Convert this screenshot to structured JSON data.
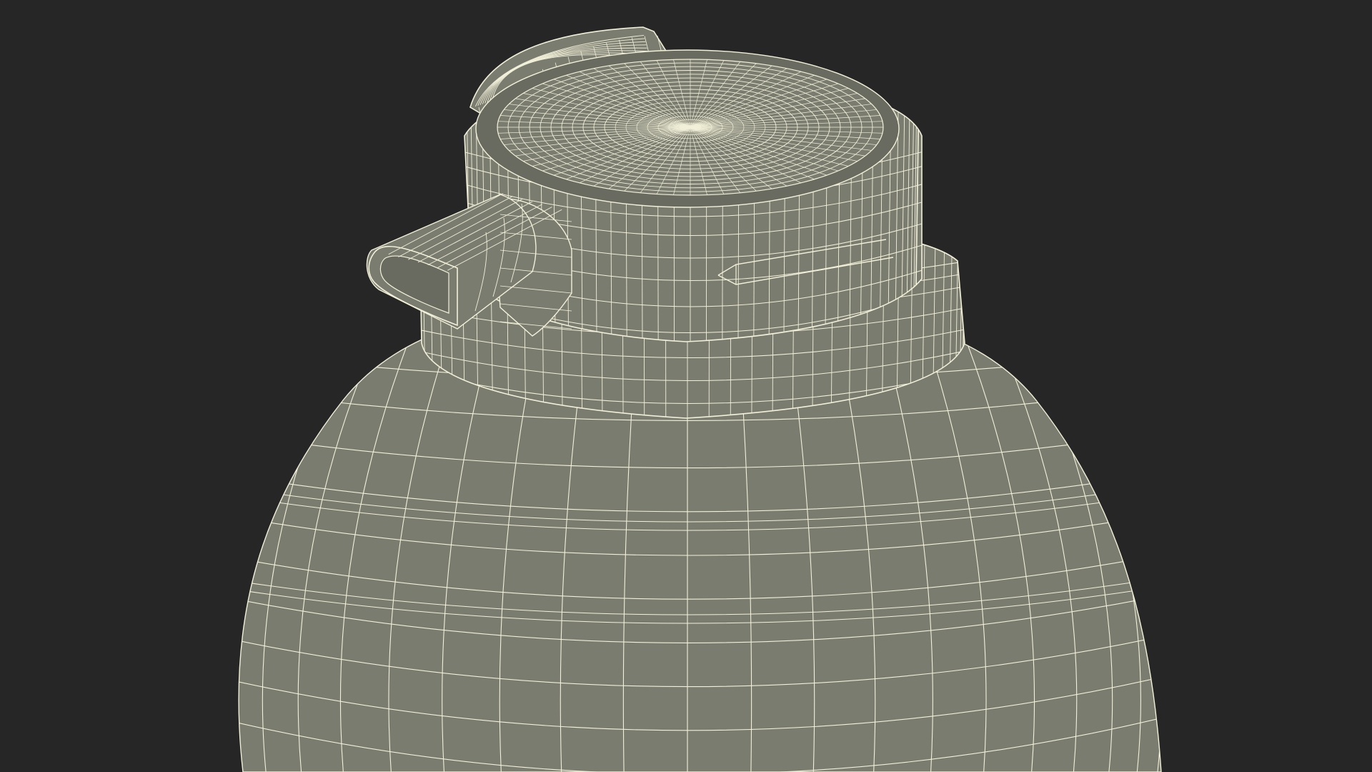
{
  "scene": {
    "subject": "wireframe-bottle-with-spout-cap",
    "background_color": "#262626",
    "surface_color": "#7b7c70",
    "surface_dark_color": "#6a6b60",
    "wire_color": "#f2f0d8"
  }
}
